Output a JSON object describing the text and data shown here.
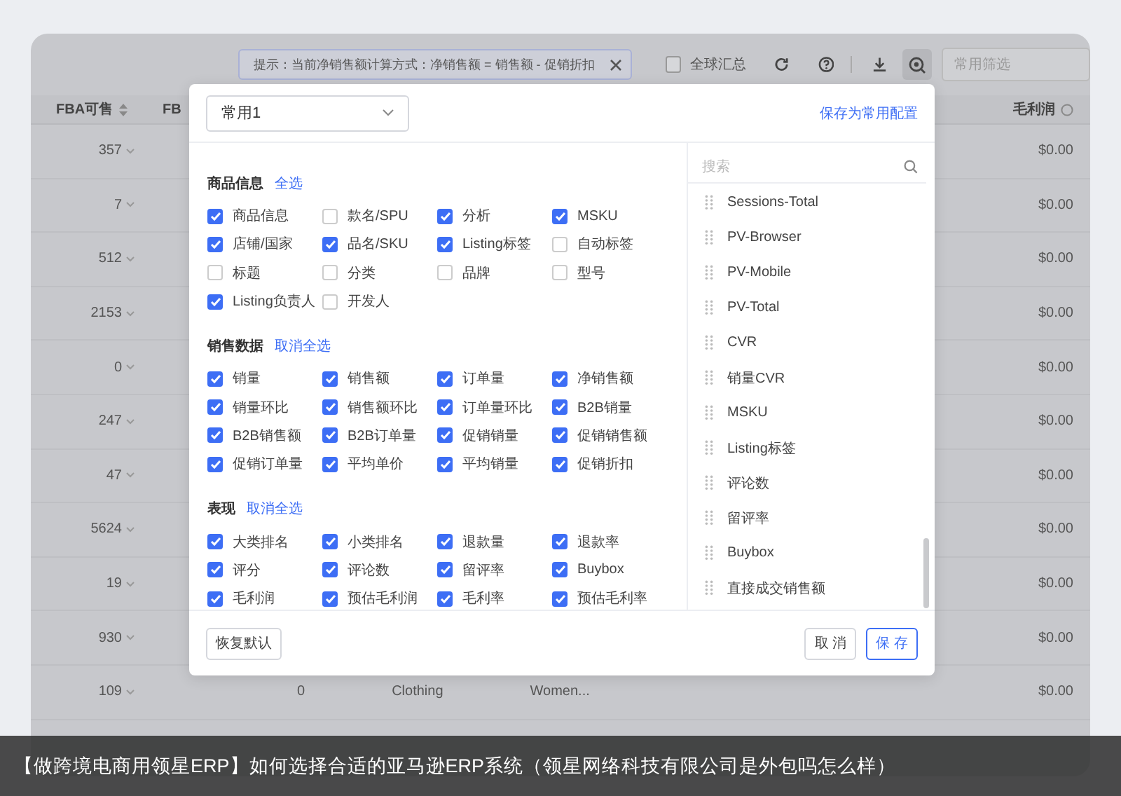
{
  "toolbar": {
    "hint": "提示：当前净销售额计算方式：净销售额 = 销售额 - 促销折扣",
    "global_summary": {
      "label": "全球汇总",
      "checked": false
    },
    "filter_select": {
      "placeholder": "常用筛选"
    }
  },
  "table": {
    "columns": [
      {
        "label": "FBA可售"
      },
      {
        "label": "FB"
      },
      {
        "label": "毛利润"
      }
    ],
    "rows": [
      {
        "fba": "357",
        "margin": "$0.00"
      },
      {
        "fba": "7",
        "margin": "$0.00"
      },
      {
        "fba": "512",
        "margin": "$0.00"
      },
      {
        "fba": "2153",
        "margin": "$0.00"
      },
      {
        "fba": "0",
        "margin": "$0.00"
      },
      {
        "fba": "247",
        "margin": "$0.00"
      },
      {
        "fba": "47",
        "margin": "$0.00"
      },
      {
        "fba": "5624",
        "margin": "$0.00"
      },
      {
        "fba": "19",
        "margin": "$0.00"
      },
      {
        "fba": "930",
        "margin": "$0.00"
      },
      {
        "fba": "109",
        "margin": "$0.00",
        "middle": [
          "0",
          "Clothing",
          "Women..."
        ]
      }
    ]
  },
  "dialog": {
    "preset": "常用1",
    "save_preset": "保存为常用配置",
    "sections": [
      {
        "title": "商品信息",
        "toggle": "全选",
        "items": [
          {
            "label": "商品信息",
            "checked": true
          },
          {
            "label": "款名/SPU",
            "checked": false
          },
          {
            "label": "分析",
            "checked": true
          },
          {
            "label": "MSKU",
            "checked": true
          },
          {
            "label": "店铺/国家",
            "checked": true
          },
          {
            "label": "品名/SKU",
            "checked": true
          },
          {
            "label": "Listing标签",
            "checked": true
          },
          {
            "label": "自动标签",
            "checked": false
          },
          {
            "label": "标题",
            "checked": false
          },
          {
            "label": "分类",
            "checked": false
          },
          {
            "label": "品牌",
            "checked": false
          },
          {
            "label": "型号",
            "checked": false
          },
          {
            "label": "Listing负责人",
            "checked": true
          },
          {
            "label": "开发人",
            "checked": false
          }
        ]
      },
      {
        "title": "销售数据",
        "toggle": "取消全选",
        "items": [
          {
            "label": "销量",
            "checked": true
          },
          {
            "label": "销售额",
            "checked": true
          },
          {
            "label": "订单量",
            "checked": true
          },
          {
            "label": "净销售额",
            "checked": true
          },
          {
            "label": "销量环比",
            "checked": true
          },
          {
            "label": "销售额环比",
            "checked": true
          },
          {
            "label": "订单量环比",
            "checked": true
          },
          {
            "label": "B2B销量",
            "checked": true
          },
          {
            "label": "B2B销售额",
            "checked": true
          },
          {
            "label": "B2B订单量",
            "checked": true
          },
          {
            "label": "促销销量",
            "checked": true
          },
          {
            "label": "促销销售额",
            "checked": true
          },
          {
            "label": "促销订单量",
            "checked": true
          },
          {
            "label": "平均单价",
            "checked": true
          },
          {
            "label": "平均销量",
            "checked": true
          },
          {
            "label": "促销折扣",
            "checked": true
          }
        ]
      },
      {
        "title": "表现",
        "toggle": "取消全选",
        "items": [
          {
            "label": "大类排名",
            "checked": true
          },
          {
            "label": "小类排名",
            "checked": true
          },
          {
            "label": "退款量",
            "checked": true
          },
          {
            "label": "退款率",
            "checked": true
          },
          {
            "label": "评分",
            "checked": true
          },
          {
            "label": "评论数",
            "checked": true
          },
          {
            "label": "留评率",
            "checked": true
          },
          {
            "label": "Buybox",
            "checked": true
          },
          {
            "label": "毛利润",
            "checked": true
          },
          {
            "label": "预估毛利润",
            "checked": true
          },
          {
            "label": "毛利率",
            "checked": true
          },
          {
            "label": "预估毛利率",
            "checked": true
          }
        ]
      }
    ],
    "search": {
      "placeholder": "搜索"
    },
    "selected_columns": [
      "Sessions-Total",
      "PV-Browser",
      "PV-Mobile",
      "PV-Total",
      "CVR",
      "销量CVR",
      "MSKU",
      "Listing标签",
      "评论数",
      "留评率",
      "Buybox",
      "直接成交销售额"
    ],
    "buttons": {
      "reset": "恢复默认",
      "cancel": "取 消",
      "save": "保 存"
    }
  },
  "caption": "【做跨境电商用领星ERP】如何选择合适的亚马逊ERP系统（领星网络科技有限公司是外包吗怎么样）"
}
